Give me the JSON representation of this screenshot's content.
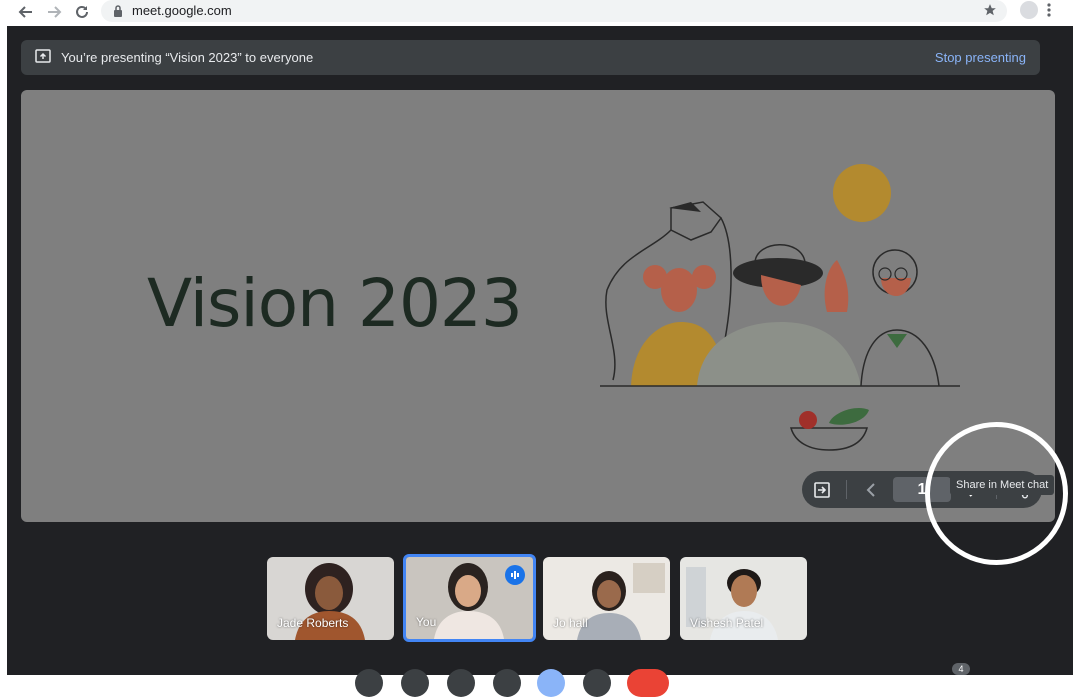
{
  "browser": {
    "url": "meet.google.com",
    "icons": [
      "back-icon",
      "forward-icon",
      "reload-icon",
      "lock-icon",
      "star-icon",
      "profile-avatar",
      "kebab-menu-icon"
    ]
  },
  "banner": {
    "text": "You’re presenting “Vision 2023” to everyone",
    "stop_label": "Stop presenting"
  },
  "slide": {
    "title": "Vision 2023"
  },
  "slide_controls": {
    "current_page": "1",
    "tooltip": "Share in Meet chat"
  },
  "participants": [
    {
      "name": "Jade Roberts",
      "speaking": false
    },
    {
      "name": "You",
      "speaking": true
    },
    {
      "name": "Jo hall",
      "speaking": false
    },
    {
      "name": "Vishesh Patel",
      "speaking": false
    }
  ],
  "toolbar": {
    "participant_count": "4"
  },
  "colors": {
    "meet_bg": "#202124",
    "stage_bg": "#7f7f7f",
    "accent": "#8ab4f8",
    "active_tile": "#4285f4"
  }
}
